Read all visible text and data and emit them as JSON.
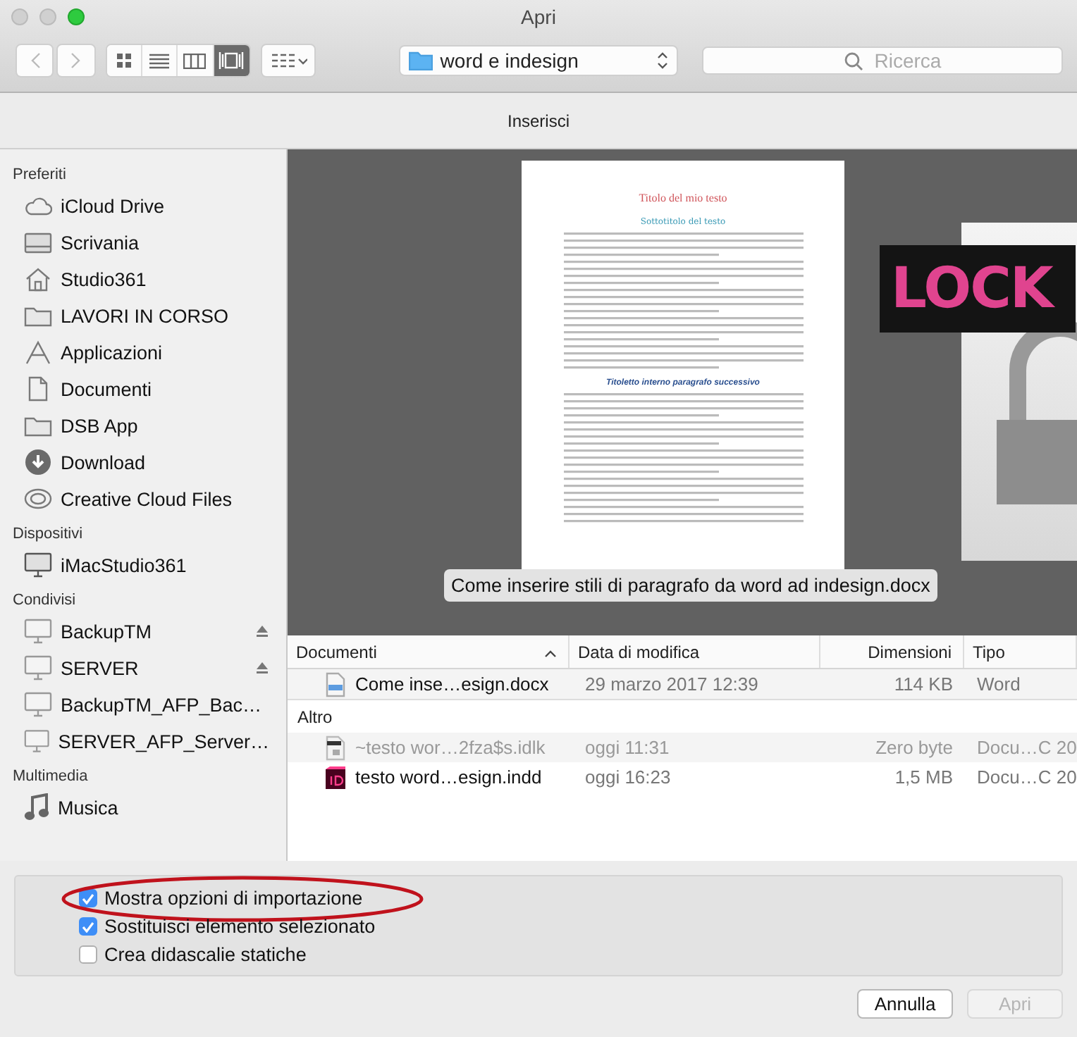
{
  "window": {
    "title": "Apri"
  },
  "toolbar": {
    "views": [
      {
        "kind": "icons",
        "selected": false
      },
      {
        "kind": "list",
        "selected": false
      },
      {
        "kind": "columns",
        "selected": false
      },
      {
        "kind": "coverflow",
        "selected": true
      }
    ],
    "location": "word e indesign",
    "search": {
      "placeholder": "Ricerca"
    }
  },
  "options_header": "Inserisci",
  "sidebar": {
    "sections": [
      {
        "title": "Preferiti",
        "items": [
          {
            "label": "iCloud Drive",
            "kind": "cloud",
            "ejectable": false
          },
          {
            "label": "Scrivania",
            "kind": "desktop",
            "ejectable": false
          },
          {
            "label": "Studio361",
            "kind": "home",
            "ejectable": false
          },
          {
            "label": "LAVORI IN CORSO",
            "kind": "folder",
            "ejectable": false
          },
          {
            "label": "Applicazioni",
            "kind": "apps",
            "ejectable": false
          },
          {
            "label": "Documenti",
            "kind": "docs",
            "ejectable": false
          },
          {
            "label": "DSB App",
            "kind": "folder",
            "ejectable": false
          },
          {
            "label": "Download",
            "kind": "download",
            "ejectable": false
          },
          {
            "label": "Creative Cloud Files",
            "kind": "cc",
            "ejectable": false
          }
        ]
      },
      {
        "title": "Dispositivi",
        "items": [
          {
            "label": "iMacStudio361",
            "kind": "computer",
            "ejectable": false
          }
        ]
      },
      {
        "title": "Condivisi",
        "items": [
          {
            "label": "BackupTM",
            "kind": "server",
            "ejectable": true
          },
          {
            "label": "SERVER",
            "kind": "server",
            "ejectable": true
          },
          {
            "label": "BackupTM_AFP_Bac…",
            "kind": "server",
            "ejectable": false
          },
          {
            "label": "SERVER_AFP_Server…",
            "kind": "server",
            "ejectable": false
          }
        ]
      },
      {
        "title": "Multimedia",
        "items": [
          {
            "label": "Musica",
            "kind": "music",
            "ejectable": false
          }
        ]
      }
    ]
  },
  "preview": {
    "document": {
      "title": "Titolo del mio testo",
      "subtitle": "Sottotitolo del testo",
      "heading": "Titoletto interno paragrafo successivo"
    },
    "lock_badge": "LOCK",
    "caption": "Come inserire stili di paragrafo da word ad indesign.docx"
  },
  "file_list": {
    "columns": [
      {
        "label": "Documenti",
        "sorted": true
      },
      {
        "label": "Data di modifica",
        "sorted": false
      },
      {
        "label": "Dimensioni",
        "sorted": false
      },
      {
        "label": "Tipo",
        "sorted": false
      }
    ],
    "groups": [
      {
        "rows": [
          {
            "name": "Come inse…esign.docx",
            "kind": "docx",
            "date": "29 marzo 2017 12:39",
            "size": "114 KB",
            "type": "Word",
            "dimmed": false
          }
        ]
      },
      {
        "title": "Altro",
        "rows": [
          {
            "name": "~testo wor…2fza$s.idlk",
            "kind": "lock",
            "date": "oggi 11:31",
            "size": "Zero byte",
            "type": "Docu…C 20",
            "dimmed": true
          },
          {
            "name": "testo word…esign.indd",
            "kind": "indd",
            "date": "oggi 16:23",
            "size": "1,5 MB",
            "type": "Docu…C 20",
            "dimmed": false
          }
        ]
      }
    ]
  },
  "options": [
    {
      "label": "Mostra opzioni di importazione",
      "checked": true,
      "circled": true
    },
    {
      "label": "Sostituisci elemento selezionato",
      "checked": true,
      "circled": false
    },
    {
      "label": "Crea didascalie statiche",
      "checked": false,
      "circled": false
    }
  ],
  "buttons": [
    {
      "label": "Annulla",
      "disabled": false
    },
    {
      "label": "Apri",
      "disabled": true
    }
  ]
}
